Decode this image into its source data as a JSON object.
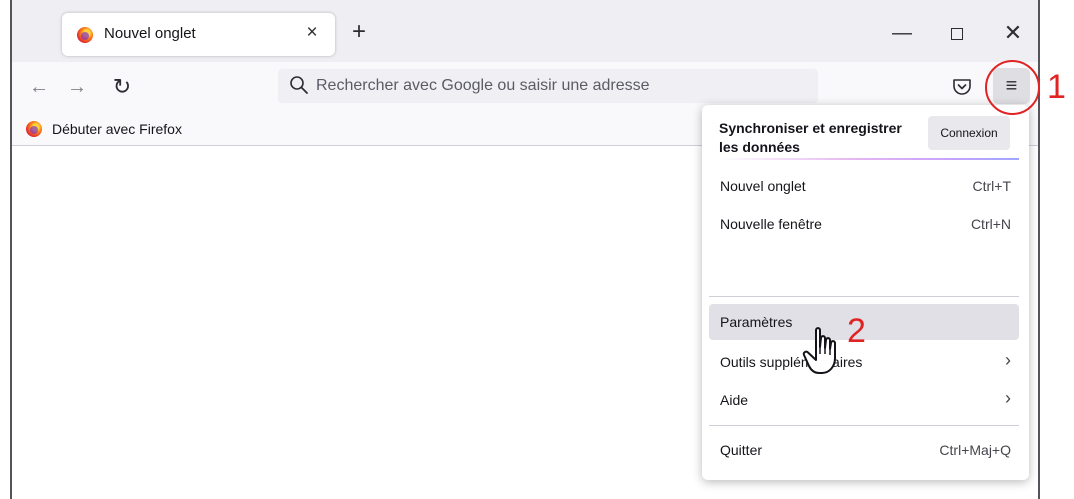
{
  "tab": {
    "title": "Nouvel onglet",
    "close_glyph": "×"
  },
  "tabstrip": {
    "new_tab_glyph": "+"
  },
  "window_controls": {
    "minimize_glyph": "—",
    "close_glyph": "✕"
  },
  "nav": {
    "back_glyph": "←",
    "forward_glyph": "→",
    "reload_glyph": "↻",
    "url_placeholder": "Rechercher avec Google ou saisir une adresse",
    "menu_glyph": "≡"
  },
  "bookmarks": {
    "items": [
      {
        "label": "Débuter avec Firefox"
      }
    ]
  },
  "menu": {
    "sync_title": "Synchroniser et enregistrer les données",
    "connect_label": "Connexion",
    "items": [
      {
        "label": "Nouvel onglet",
        "shortcut": "Ctrl+T"
      },
      {
        "label": "Nouvelle fenêtre",
        "shortcut": "Ctrl+N"
      },
      {
        "label": "Paramètres",
        "shortcut": ""
      },
      {
        "label": "Outils supplémentaires",
        "chevron": "›"
      },
      {
        "label": "Aide",
        "chevron": "›"
      },
      {
        "label": "Quitter",
        "shortcut": "Ctrl+Maj+Q"
      }
    ]
  },
  "annotations": {
    "step1": "1",
    "step2": "2",
    "color": "#e02323"
  },
  "icons": {
    "tab_favicon": "firefox-logo-icon",
    "search": "search-icon",
    "pocket": "pocket-icon",
    "menu": "hamburger-menu-icon",
    "cursor": "hand-cursor-icon"
  }
}
